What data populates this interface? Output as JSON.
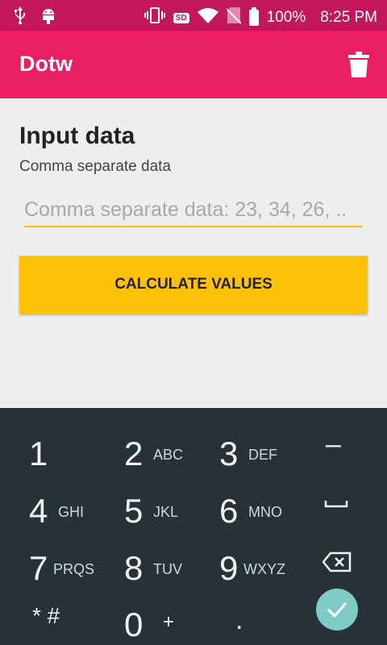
{
  "status_bar": {
    "battery_percent": "100%",
    "time": "8:25 PM",
    "sd_label": "SD",
    "icons": [
      "usb-icon",
      "android-debug-icon",
      "vibrate-icon",
      "sd-card-icon",
      "wifi-icon",
      "no-sim-icon",
      "battery-icon"
    ]
  },
  "app_bar": {
    "title": "Dotw",
    "action_icon": "delete-icon"
  },
  "main": {
    "heading": "Input data",
    "subheading": "Comma separate data",
    "input": {
      "value": "",
      "placeholder": "Comma separate data: 23, 34, 26, .."
    },
    "calculate_label": "CALCULATE VALUES"
  },
  "keyboard": {
    "rows": [
      [
        {
          "num": "1",
          "letters": ""
        },
        {
          "num": "2",
          "letters": "ABC"
        },
        {
          "num": "3",
          "letters": "DEF"
        },
        {
          "sym": "–"
        }
      ],
      [
        {
          "num": "4",
          "letters": "GHI"
        },
        {
          "num": "5",
          "letters": "JKL"
        },
        {
          "num": "6",
          "letters": "MNO"
        },
        {
          "sym": "space"
        }
      ],
      [
        {
          "num": "7",
          "letters": "PRQS"
        },
        {
          "num": "8",
          "letters": "TUV"
        },
        {
          "num": "9",
          "letters": "WXYZ"
        },
        {
          "sym": "backspace"
        }
      ],
      [
        {
          "sym": "* #"
        },
        {
          "num": "0",
          "letters": "+"
        },
        {
          "sym": "."
        },
        {
          "sym": "done"
        }
      ]
    ],
    "accent_done": "#80cbc4"
  },
  "colors": {
    "status_bar": "#c2185b",
    "app_bar": "#e91e63",
    "accent": "#ffc107",
    "keyboard_bg": "#263238"
  }
}
